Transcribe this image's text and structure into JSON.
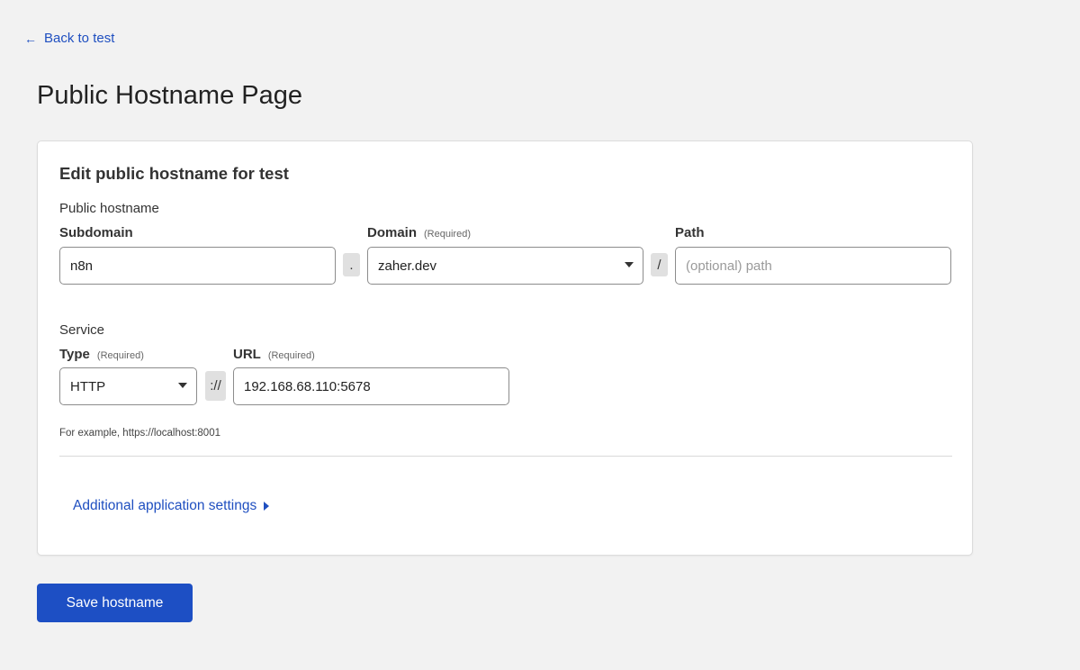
{
  "nav": {
    "back_icon": "arrow-left",
    "back_label": "Back to test"
  },
  "page": {
    "title": "Public Hostname Page"
  },
  "form": {
    "title": "Edit public hostname for test",
    "hostname_section": "Public hostname",
    "subdomain": {
      "label": "Subdomain",
      "value": "n8n"
    },
    "dot_separator": ".",
    "domain": {
      "label": "Domain",
      "required": "(Required)",
      "value": "zaher.dev"
    },
    "slash_separator": "/",
    "path": {
      "label": "Path",
      "placeholder": "(optional) path",
      "value": ""
    },
    "service_section": "Service",
    "type": {
      "label": "Type",
      "required": "(Required)",
      "value": "HTTP"
    },
    "scheme_separator": "://",
    "url": {
      "label": "URL",
      "required": "(Required)",
      "value": "192.168.68.110:5678"
    },
    "hint": "For example, https://localhost:8001",
    "additional_settings": "Additional application settings"
  },
  "actions": {
    "save_label": "Save hostname"
  },
  "colors": {
    "accent": "#1d4fc4",
    "link": "#1f4fc0",
    "background": "#f2f2f2"
  }
}
